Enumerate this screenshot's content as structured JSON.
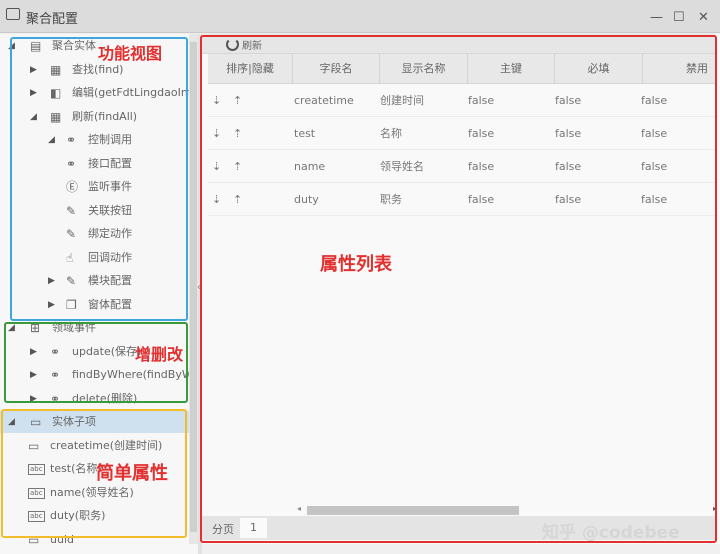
{
  "window": {
    "title": "聚合配置",
    "minimize": "—",
    "maximize": "☐",
    "close": "✕"
  },
  "tree": [
    {
      "label": "聚合实体",
      "level": 0,
      "arrow": "◢",
      "icon": "entity-icon",
      "glyph": "▤"
    },
    {
      "label": "查找(find)",
      "level": 1,
      "arrow": "▶",
      "icon": "table-icon",
      "glyph": "▦"
    },
    {
      "label": "编辑(getFdtLingdaoInfo)",
      "level": 1,
      "arrow": "▶",
      "icon": "form-icon",
      "glyph": "◧"
    },
    {
      "label": "刷新(findAll)",
      "level": 1,
      "arrow": "◢",
      "icon": "table-icon",
      "glyph": "▦"
    },
    {
      "label": "控制调用",
      "level": 2,
      "arrow": "◢",
      "icon": "link-icon",
      "glyph": "⚭"
    },
    {
      "label": "接口配置",
      "level": 2,
      "arrow": "",
      "icon": "link-icon",
      "glyph": "⚭"
    },
    {
      "label": "监听事件",
      "level": 2,
      "arrow": "",
      "icon": "event-icon",
      "glyph": "Ⓔ"
    },
    {
      "label": "关联按钮",
      "level": 2,
      "arrow": "",
      "icon": "edit-doc-icon",
      "glyph": "✎"
    },
    {
      "label": "绑定动作",
      "level": 2,
      "arrow": "",
      "icon": "edit-doc-icon",
      "glyph": "✎"
    },
    {
      "label": "回调动作",
      "level": 2,
      "arrow": "",
      "icon": "hand-icon",
      "glyph": "☝"
    },
    {
      "label": "模块配置",
      "level": 2,
      "arrow": "▶",
      "icon": "edit-doc-icon",
      "glyph": "✎"
    },
    {
      "label": "窗体配置",
      "level": 2,
      "arrow": "▶",
      "icon": "window-doc-icon",
      "glyph": "❐"
    },
    {
      "label": "领域事件",
      "level": 0,
      "arrow": "◢",
      "icon": "grid-icon",
      "glyph": "⊞"
    },
    {
      "label": "update(保存)",
      "level": 1,
      "arrow": "▶",
      "icon": "link-icon",
      "glyph": "⚭"
    },
    {
      "label": "findByWhere(findByWhere)",
      "level": 1,
      "arrow": "▶",
      "icon": "link-icon",
      "glyph": "⚭"
    },
    {
      "label": "delete(删除)",
      "level": 1,
      "arrow": "▶",
      "icon": "link-icon",
      "glyph": "⚭"
    },
    {
      "label": "实体子项",
      "level": 0,
      "arrow": "◢",
      "icon": "field-icon",
      "glyph": "▭",
      "selected": true
    },
    {
      "label": "createtime(创建时间)",
      "level": -1,
      "arrow": "",
      "icon": "field-icon",
      "glyph": "▭"
    },
    {
      "label": "test(名称)",
      "level": -1,
      "arrow": "",
      "icon": "abc-icon",
      "glyph": "abc"
    },
    {
      "label": "name(领导姓名)",
      "level": -1,
      "arrow": "",
      "icon": "abc-icon",
      "glyph": "abc"
    },
    {
      "label": "duty(职务)",
      "level": -1,
      "arrow": "",
      "icon": "abc-icon",
      "glyph": "abc"
    },
    {
      "label": "uuid",
      "level": -1,
      "arrow": "",
      "icon": "field-icon",
      "glyph": "▭"
    }
  ],
  "toolbar": {
    "refresh": "刷新"
  },
  "table": {
    "columns": [
      "排序|隐藏",
      "字段名",
      "显示名称",
      "主键",
      "必填",
      "禁用"
    ],
    "rows": [
      {
        "field": "createtime",
        "display": "创建时间",
        "pk": "false",
        "required": "false",
        "disabled": "false"
      },
      {
        "field": "test",
        "display": "名称",
        "pk": "false",
        "required": "false",
        "disabled": "false"
      },
      {
        "field": "name",
        "display": "领导姓名",
        "pk": "false",
        "required": "false",
        "disabled": "false"
      },
      {
        "field": "duty",
        "display": "职务",
        "pk": "false",
        "required": "false",
        "disabled": "false"
      }
    ],
    "sort_down": "⇣",
    "sort_up": "⇡"
  },
  "pager": {
    "label": "分页",
    "page": "1"
  },
  "annotations": {
    "functional_view": "功能视图",
    "crud": "增删改",
    "simple_attrs": "简单属性",
    "attr_list": "属性列表"
  },
  "watermark": "知乎 @codebee"
}
